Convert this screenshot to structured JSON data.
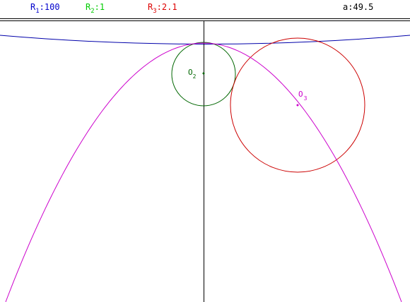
{
  "readouts": {
    "r1": {
      "letter": "R",
      "sub": "1",
      "sep": ":",
      "value": "100",
      "color": "#0000cc"
    },
    "r2": {
      "letter": "R",
      "sub": "2",
      "sep": ":",
      "value": "1",
      "color": "#00cc00"
    },
    "r3": {
      "letter": "R",
      "sub": "3",
      "sep": ":",
      "value": "2.1",
      "color": "#dd0000"
    },
    "angle": {
      "label": "a",
      "sep": ":",
      "value": "49.5",
      "color": "#000000"
    }
  },
  "points": {
    "o2": {
      "letter": "O",
      "sub": "2",
      "color": "#006600"
    },
    "o3": {
      "letter": "O",
      "sub": "3",
      "color": "#cc00cc"
    }
  },
  "colors": {
    "big_circle": "#0000aa",
    "small_circle": "#006600",
    "red_circle": "#cc0000",
    "parabola": "#cc00cc",
    "axis": "#000000"
  }
}
